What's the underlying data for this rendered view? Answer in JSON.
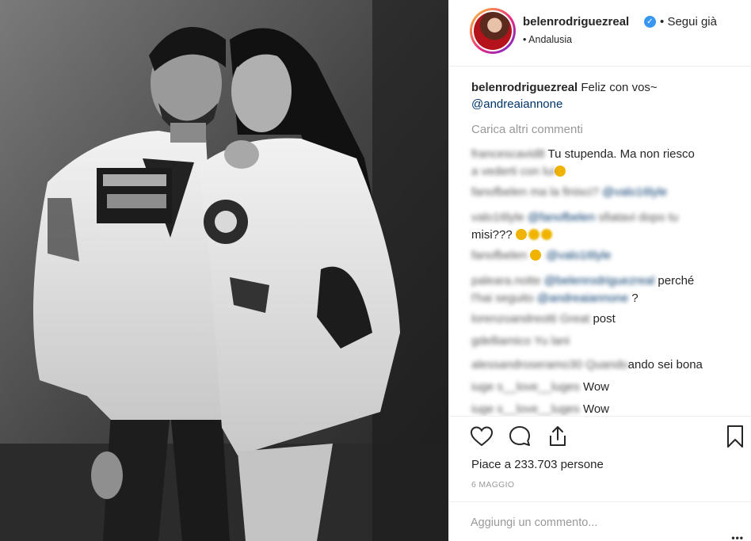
{
  "post": {
    "username": "belenrodriguezreal",
    "follow_separator": "•",
    "follow_label": "Segui già",
    "location": "• Andalusia",
    "verified_mark": "✓"
  },
  "caption": {
    "username": "belenrodriguezreal",
    "text": "Feliz con vos~",
    "mention": "@andreaiannone"
  },
  "load_more_label": "Carica altri commenti",
  "comments": [
    {
      "user": "francescavid8",
      "text_a": "Tu stupenda. Ma non riesco",
      "text_b": "a vederti con lui"
    },
    {
      "user": "fanofbelen",
      "text_a": "ma la finisci?",
      "mention": "@valo16lyle"
    },
    {
      "user": "valo16lyle",
      "mention": "@fanofbelen",
      "text_a": "sfiatavi dopo tu",
      "text_b": "misi???"
    },
    {
      "user": "fanofbelen",
      "mention": "@valo16lyle"
    },
    {
      "user": "paleara.notte",
      "mention": "@belenrodriguezreal",
      "text_a": "perché",
      "text_b": "l'hai seguito",
      "mention_b": "@andreaiannone",
      "text_c": "?"
    },
    {
      "user": "lorenzoandreotti",
      "text_a": "Great",
      "text_b": "post"
    },
    {
      "user": "gdelliamico",
      "text_a": "Yu lani"
    },
    {
      "user": "alessandroseramo30",
      "text_a": "Quando",
      "text_b": "ando sei bona"
    },
    {
      "user": "iuge",
      "text_a": "s__love__luges",
      "text_b": "Wow"
    },
    {
      "user": "iuge",
      "text_a": "s__love__luges",
      "text_b": "Wow"
    }
  ],
  "actions": {
    "like_icon": "heart-outline-icon",
    "comment_icon": "speech-bubble-icon",
    "share_icon": "share-upload-icon",
    "save_icon": "bookmark-icon"
  },
  "likes_text": "Piace a 233.703 persone",
  "date_text": "6 MAGGIO",
  "add_comment_placeholder": "Aggiungi un commento...",
  "more_label": "•••",
  "colors": {
    "link": "#003569",
    "muted": "#999999",
    "text": "#262626",
    "verified": "#3897f0"
  }
}
